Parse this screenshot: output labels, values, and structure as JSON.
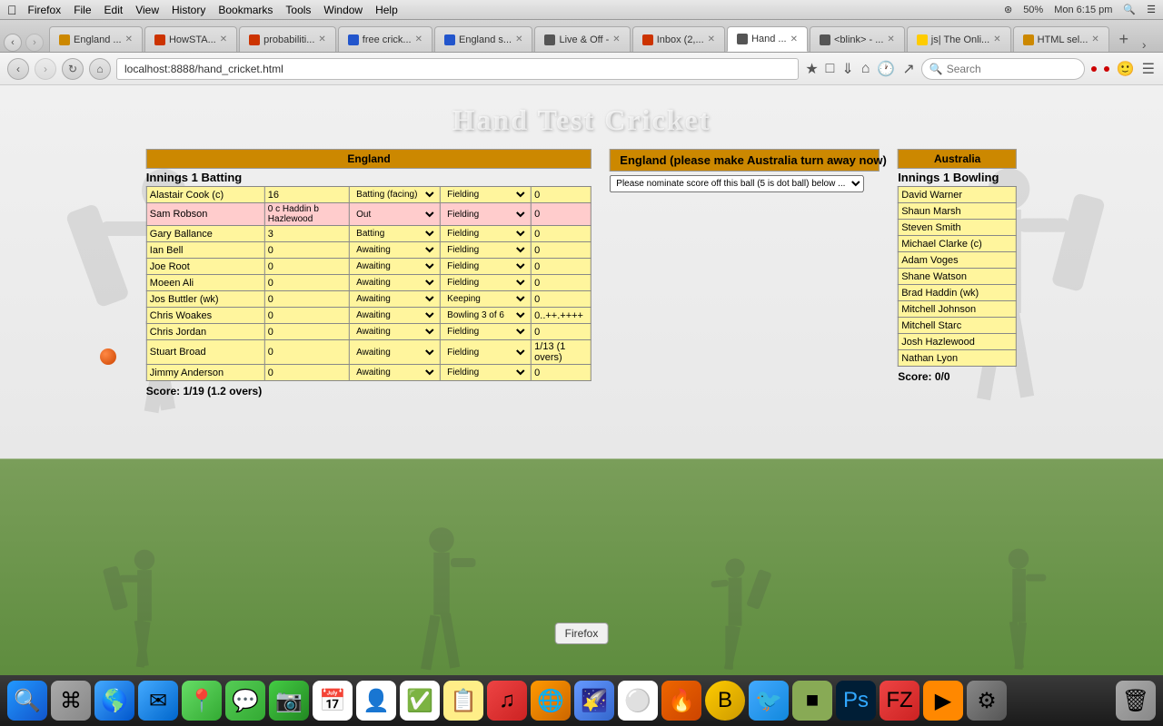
{
  "browser": {
    "mac_menu": [
      "Firefox",
      "File",
      "Edit",
      "View",
      "History",
      "Bookmarks",
      "Tools",
      "Window",
      "Help"
    ],
    "time": "Mon 6:15 pm",
    "battery": "50%",
    "tabs": [
      {
        "label": "England ...",
        "active": false,
        "color": "#cc8800"
      },
      {
        "label": "HowSTA...",
        "active": false,
        "color": "#cc3300"
      },
      {
        "label": "probabiliti...",
        "active": false,
        "color": "#cc3300"
      },
      {
        "label": "free crick...",
        "active": false,
        "color": "#2255cc"
      },
      {
        "label": "England s...",
        "active": false,
        "color": "#2255cc"
      },
      {
        "label": "Live & Off -",
        "active": false,
        "color": "#555"
      },
      {
        "label": "Inbox (2,...",
        "active": false,
        "color": "#cc3300"
      },
      {
        "label": "Hand ...",
        "active": true,
        "color": "#555"
      },
      {
        "label": "<blink> - ...",
        "active": false,
        "color": "#555"
      },
      {
        "label": "js| The Onli...",
        "active": false,
        "color": "#ffcc00"
      },
      {
        "label": "HTML sel...",
        "active": false,
        "color": "#cc8800"
      }
    ],
    "address": "localhost:8888/hand_cricket.html",
    "search_placeholder": "Search"
  },
  "page": {
    "title": "Hand Test Cricket",
    "main_header": "England (please make Australia turn away now)",
    "nominate_label": "Please nominate score off this ball (5 is dot ball) below ..."
  },
  "england": {
    "team_label": "England",
    "innings_label": "Innings 1 Batting",
    "players": [
      {
        "name": "Alastair Cook (c)",
        "score": "16",
        "status": "Batting (facing)",
        "fielding": "Fielding",
        "number": "0",
        "style": "yellow"
      },
      {
        "name": "Sam Robson",
        "score": "0  c Haddin b Hazlewood",
        "status": "Out",
        "fielding": "Fielding",
        "number": "0",
        "style": "pink"
      },
      {
        "name": "Gary Ballance",
        "score": "3",
        "status": "Batting",
        "fielding": "Fielding",
        "number": "0",
        "style": "yellow"
      },
      {
        "name": "Ian Bell",
        "score": "0",
        "status": "Awaiting",
        "fielding": "Fielding",
        "number": "0",
        "style": "yellow"
      },
      {
        "name": "Joe Root",
        "score": "0",
        "status": "Awaiting",
        "fielding": "Fielding",
        "number": "0",
        "style": "yellow"
      },
      {
        "name": "Moeen Ali",
        "score": "0",
        "status": "Awaiting",
        "fielding": "Fielding",
        "number": "0",
        "style": "yellow"
      },
      {
        "name": "Jos Buttler (wk)",
        "score": "0",
        "status": "Awaiting",
        "fielding": "Keeping",
        "number": "0",
        "style": "yellow"
      },
      {
        "name": "Chris Woakes",
        "score": "0",
        "status": "Awaiting",
        "fielding": "Bowling 3 of 6",
        "number": "0..++.++++",
        "style": "yellow"
      },
      {
        "name": "Chris Jordan",
        "score": "0",
        "status": "Awaiting",
        "fielding": "Fielding",
        "number": "0",
        "style": "yellow"
      },
      {
        "name": "Stuart Broad",
        "score": "0",
        "status": "Awaiting",
        "fielding": "Fielding",
        "number": "1/13 (1 overs)",
        "style": "yellow"
      },
      {
        "name": "Jimmy Anderson",
        "score": "0",
        "status": "Awaiting",
        "fielding": "Fielding",
        "number": "0",
        "style": "yellow"
      }
    ],
    "score": "Score: 1/19 (1.2 overs)"
  },
  "australia": {
    "team_label": "Australia",
    "innings_label": "Innings 1 Bowling",
    "players": [
      {
        "name": "David Warner",
        "style": "yellow"
      },
      {
        "name": "Shaun Marsh",
        "style": "yellow"
      },
      {
        "name": "Steven Smith",
        "style": "yellow"
      },
      {
        "name": "Michael Clarke (c)",
        "style": "yellow"
      },
      {
        "name": "Adam Voges",
        "style": "yellow"
      },
      {
        "name": "Shane Watson",
        "style": "yellow"
      },
      {
        "name": "Brad Haddin (wk)",
        "style": "yellow"
      },
      {
        "name": "Mitchell Johnson",
        "style": "yellow"
      },
      {
        "name": "Mitchell Starc",
        "style": "yellow"
      },
      {
        "name": "Josh Hazlewood",
        "style": "yellow"
      },
      {
        "name": "Nathan Lyon",
        "style": "yellow"
      }
    ],
    "score": "Score: 0/0"
  },
  "firefox_tooltip": "Firefox"
}
